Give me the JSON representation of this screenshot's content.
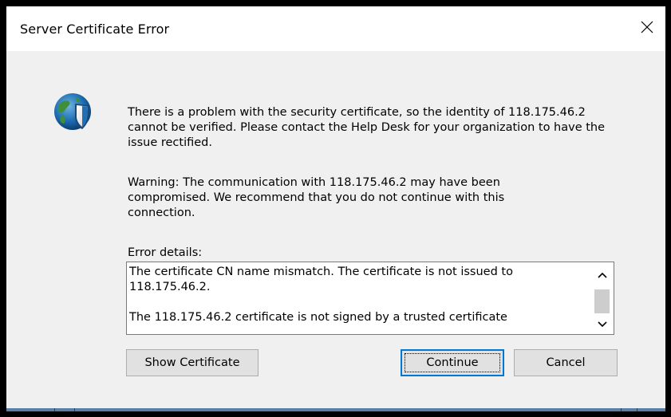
{
  "window": {
    "title": "Server Certificate Error",
    "close_icon": "close-icon"
  },
  "dialog": {
    "icon": "globe-shield-icon",
    "message": "There is a problem with the security certificate, so the identity of 118.175.46.2 cannot be verified. Please contact the Help Desk for your organization to have the issue rectified.",
    "warning": "Warning: The communication with 118.175.46.2 may have been compromised. We recommend that you do not continue with this connection.",
    "error_details_label": "Error details:",
    "error_details_lines": [
      "The certificate CN name mismatch. The certificate is not issued to 118.175.46.2.",
      "The 118.175.46.2 certificate is not signed by a trusted certificate"
    ]
  },
  "buttons": {
    "show_certificate": "Show Certificate",
    "continue": "Continue",
    "cancel": "Cancel"
  },
  "colors": {
    "focus_border": "#0078d7",
    "dialog_bg": "#f0f0f0",
    "titlebar_bg": "#ffffff"
  }
}
